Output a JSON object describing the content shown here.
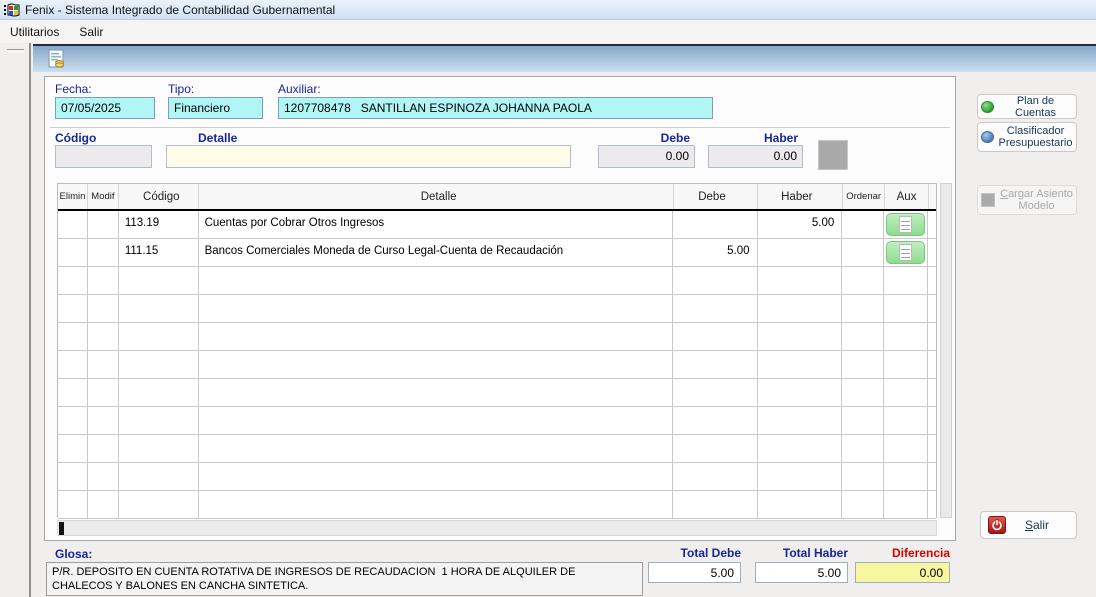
{
  "window": {
    "title": "Fenix - Sistema Integrado de Contabilidad Gubernamental"
  },
  "menu": {
    "items": [
      "Utilitarios",
      "Salir"
    ]
  },
  "header_fields": {
    "fecha_label": "Fecha:",
    "fecha_value": "07/05/2025",
    "tipo_label": "Tipo:",
    "tipo_value": "Financiero",
    "auxiliar_label": "Auxiliar:",
    "auxiliar_value": "1207708478   SANTILLAN ESPINOZA JOHANNA PAOLA"
  },
  "entry": {
    "codigo_label": "Código",
    "codigo_value": "",
    "detalle_label": "Detalle",
    "detalle_value": "",
    "debe_label": "Debe",
    "debe_value": "0.00",
    "haber_label": "Haber",
    "haber_value": "0.00"
  },
  "table": {
    "headers": [
      "Elimin",
      "Modif",
      "Código",
      "Detalle",
      "Debe",
      "Haber",
      "Ordenar",
      "Aux"
    ],
    "rows": [
      {
        "codigo": "113.19",
        "detalle": "Cuentas por Cobrar Otros Ingresos",
        "debe": "",
        "haber": "5.00"
      },
      {
        "codigo": "111.15",
        "detalle": "Bancos Comerciales Moneda de Curso Legal-Cuenta de Recaudación",
        "debe": "5.00",
        "haber": ""
      }
    ],
    "empty_rows": 9
  },
  "side_buttons": {
    "plan_cuentas": "Plan de Cuentas",
    "clasificador": "Clasificador Presupuestario",
    "cargar_asiento": "Cargar Asiento Modelo",
    "salir": "Salir"
  },
  "footer": {
    "glosa_label": "Glosa:",
    "glosa_value": "P/R. DEPOSITO EN CUENTA ROTATIVA DE INGRESOS DE RECAUDACION  1 HORA DE ALQUILER DE CHALECOS Y BALONES EN CANCHA SINTETICA.",
    "total_debe_label": "Total Debe",
    "total_debe_value": "5.00",
    "total_haber_label": "Total Haber",
    "total_haber_value": "5.00",
    "diferencia_label": "Diferencia",
    "diferencia_value": "0.00"
  },
  "icons": {
    "app_icon": "windows-logo-icon",
    "toolbar_icon": "new-entry-document-coins-icon",
    "aux_icon": "document-icon",
    "plan_icon": "green-sphere-icon",
    "clasificador_icon": "blue-sphere-icon",
    "cargar_icon": "gray-square-icon",
    "salir_icon": "power-icon"
  },
  "colors": {
    "field_cyan": "#b0f6f6",
    "field_ivory": "#fffdea",
    "field_gray": "#eceaea",
    "diferencia_yellow": "#f9f6a2",
    "label_navy": "#16259a",
    "diferencia_red": "#dd0000",
    "aux_green": "#8edc8e",
    "toolbar_blue_top": "#87a8cb",
    "toolbar_blue_bottom": "#cde0f0"
  }
}
